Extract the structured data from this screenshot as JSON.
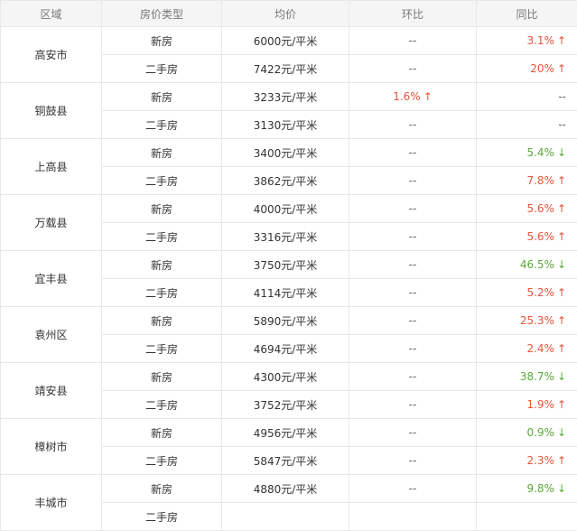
{
  "headers": [
    "区域",
    "房价类型",
    "均价",
    "环比",
    "同比"
  ],
  "arrows": {
    "up": "↑",
    "down": "↓"
  },
  "colors": {
    "up": "#e4553a",
    "down": "#5aa83b",
    "header_bg": "#f5f5f5",
    "border": "#e8e8e8"
  },
  "rows": [
    {
      "district": "高安市",
      "new": {
        "type": "新房",
        "price": "6000元/平米",
        "mom": "--",
        "yoy": "3.1%",
        "yoy_dir": "up"
      },
      "used": {
        "type": "二手房",
        "price": "7422元/平米",
        "mom": "--",
        "yoy": "20%",
        "yoy_dir": "up"
      }
    },
    {
      "district": "铜鼓县",
      "new": {
        "type": "新房",
        "price": "3233元/平米",
        "mom": "1.6%",
        "mom_dir": "up",
        "yoy": "--"
      },
      "used": {
        "type": "二手房",
        "price": "3130元/平米",
        "mom": "--",
        "yoy": "--"
      }
    },
    {
      "district": "上高县",
      "new": {
        "type": "新房",
        "price": "3400元/平米",
        "mom": "--",
        "yoy": "5.4%",
        "yoy_dir": "down"
      },
      "used": {
        "type": "二手房",
        "price": "3862元/平米",
        "mom": "--",
        "yoy": "7.8%",
        "yoy_dir": "up"
      }
    },
    {
      "district": "万载县",
      "new": {
        "type": "新房",
        "price": "4000元/平米",
        "mom": "--",
        "yoy": "5.6%",
        "yoy_dir": "up"
      },
      "used": {
        "type": "二手房",
        "price": "3316元/平米",
        "mom": "--",
        "yoy": "5.6%",
        "yoy_dir": "up"
      }
    },
    {
      "district": "宜丰县",
      "new": {
        "type": "新房",
        "price": "3750元/平米",
        "mom": "--",
        "yoy": "46.5%",
        "yoy_dir": "down"
      },
      "used": {
        "type": "二手房",
        "price": "4114元/平米",
        "mom": "--",
        "yoy": "5.2%",
        "yoy_dir": "up"
      }
    },
    {
      "district": "袁州区",
      "new": {
        "type": "新房",
        "price": "5890元/平米",
        "mom": "--",
        "yoy": "25.3%",
        "yoy_dir": "up"
      },
      "used": {
        "type": "二手房",
        "price": "4694元/平米",
        "mom": "--",
        "yoy": "2.4%",
        "yoy_dir": "up"
      }
    },
    {
      "district": "靖安县",
      "new": {
        "type": "新房",
        "price": "4300元/平米",
        "mom": "--",
        "yoy": "38.7%",
        "yoy_dir": "down"
      },
      "used": {
        "type": "二手房",
        "price": "3752元/平米",
        "mom": "--",
        "yoy": "1.9%",
        "yoy_dir": "up"
      }
    },
    {
      "district": "樟树市",
      "new": {
        "type": "新房",
        "price": "4956元/平米",
        "mom": "--",
        "yoy": "0.9%",
        "yoy_dir": "down"
      },
      "used": {
        "type": "二手房",
        "price": "5847元/平米",
        "mom": "--",
        "yoy": "2.3%",
        "yoy_dir": "up"
      }
    },
    {
      "district": "丰城市",
      "new": {
        "type": "新房",
        "price": "4880元/平米",
        "mom": "--",
        "yoy": "9.8%",
        "yoy_dir": "down"
      },
      "used": {
        "type": "二手房",
        "price": "",
        "mom": "",
        "yoy": ""
      }
    }
  ]
}
